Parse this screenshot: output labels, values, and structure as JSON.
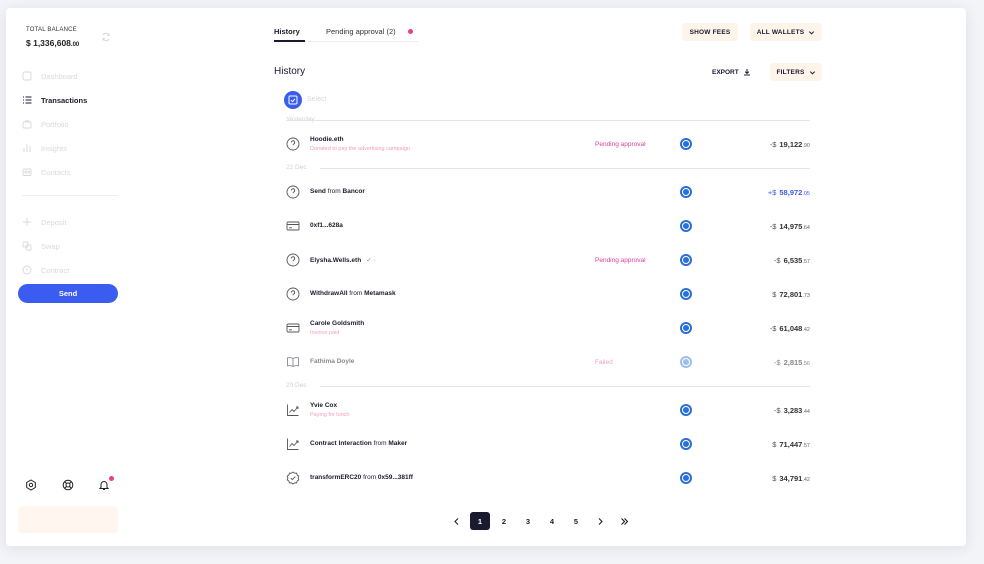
{
  "sidebar": {
    "balance_label": "TOTAL BALANCE",
    "balance_main": "$ 1,336,608",
    "balance_cents": ".00",
    "nav": [
      {
        "label": "Dashboard",
        "icon": "dashboard-icon",
        "active": false
      },
      {
        "label": "Transactions",
        "icon": "list-icon",
        "active": true
      },
      {
        "label": "Portfolio",
        "icon": "briefcase-icon",
        "active": false
      },
      {
        "label": "Insights",
        "icon": "bar-chart-icon",
        "active": false
      },
      {
        "label": "Contacts",
        "icon": "contacts-icon",
        "active": false
      }
    ],
    "actions": [
      {
        "label": "Deposit",
        "icon": "plus-icon"
      },
      {
        "label": "Swap",
        "icon": "swap-icon"
      },
      {
        "label": "Contract",
        "icon": "contract-icon"
      }
    ],
    "send_label": "Send",
    "bottom_icons": [
      "settings-icon",
      "support-icon",
      "bell-icon"
    ]
  },
  "tabs": [
    {
      "label": "History",
      "active": true
    },
    {
      "label": "Pending approval (2)",
      "active": false
    }
  ],
  "toolbar": {
    "show_fees": "SHOW FEES",
    "all_wallets": "ALL WALLETS",
    "export": "EXPORT",
    "filters": "FILTERS"
  },
  "history_title": "History",
  "select_label": "Select",
  "groups": [
    {
      "label": "Yesterday",
      "rows": [
        {
          "icon": "question-circle-icon",
          "title": "Hoodie.eth",
          "subtitle": "Donated to pay the advertising campaign",
          "status": "Pending approval",
          "sign": "-$",
          "amount": "19,122",
          "cents": ".90"
        }
      ]
    },
    {
      "label": "22 Dec",
      "rows": [
        {
          "icon": "question-circle-icon",
          "title": "Send",
          "title_mid": " from ",
          "title_end": "Bancor",
          "sign": "+$",
          "amount": "58,972",
          "cents": ".05",
          "positive": true
        },
        {
          "icon": "card-icon",
          "title": "0xf1...628a",
          "sign": "-$",
          "amount": "14,975",
          "cents": ".64"
        },
        {
          "icon": "question-circle-icon",
          "title": "Elysha.Wells.eth",
          "status": "Pending approval",
          "sign": "-$",
          "amount": "6,535",
          "cents": ".57",
          "verified": true
        },
        {
          "icon": "question-circle-icon",
          "title": "WithdrawAll",
          "title_mid": " from ",
          "title_end": "Metamask",
          "sign": "$",
          "amount": "72,801",
          "cents": ".73"
        },
        {
          "icon": "card-icon",
          "title": "Carole Goldsmith",
          "subtitle": "Invoice paid",
          "sign": "-$",
          "amount": "61,048",
          "cents": ".42"
        },
        {
          "icon": "book-icon",
          "title": "Fathima Doyle",
          "status": "Failed",
          "sign": "-$",
          "amount": "2,815",
          "cents": ".56",
          "dim": true
        }
      ]
    },
    {
      "label": "20 Dec",
      "rows": [
        {
          "icon": "trend-up-icon",
          "title": "Yvie Cox",
          "subtitle": "Paying for lunch",
          "sign": "-$",
          "amount": "3,283",
          "cents": ".44"
        },
        {
          "icon": "trend-up-icon",
          "title": "Contract Interaction",
          "title_mid": " from ",
          "title_end": "Maker",
          "sign": "$",
          "amount": "71,447",
          "cents": ".57"
        },
        {
          "icon": "badge-check-icon",
          "title": "transformERC20",
          "title_mid": " from ",
          "title_end": "0x59...381ff",
          "sign": "$",
          "amount": "34,791",
          "cents": ".42"
        }
      ]
    }
  ],
  "pagination": {
    "pages": [
      "1",
      "2",
      "3",
      "4",
      "5"
    ],
    "active": "1"
  },
  "colors": {
    "accent": "#3b5cf0",
    "pending": "#e0409a",
    "chip_bg": "#fff4ea",
    "coin": "#2a6fd6"
  }
}
